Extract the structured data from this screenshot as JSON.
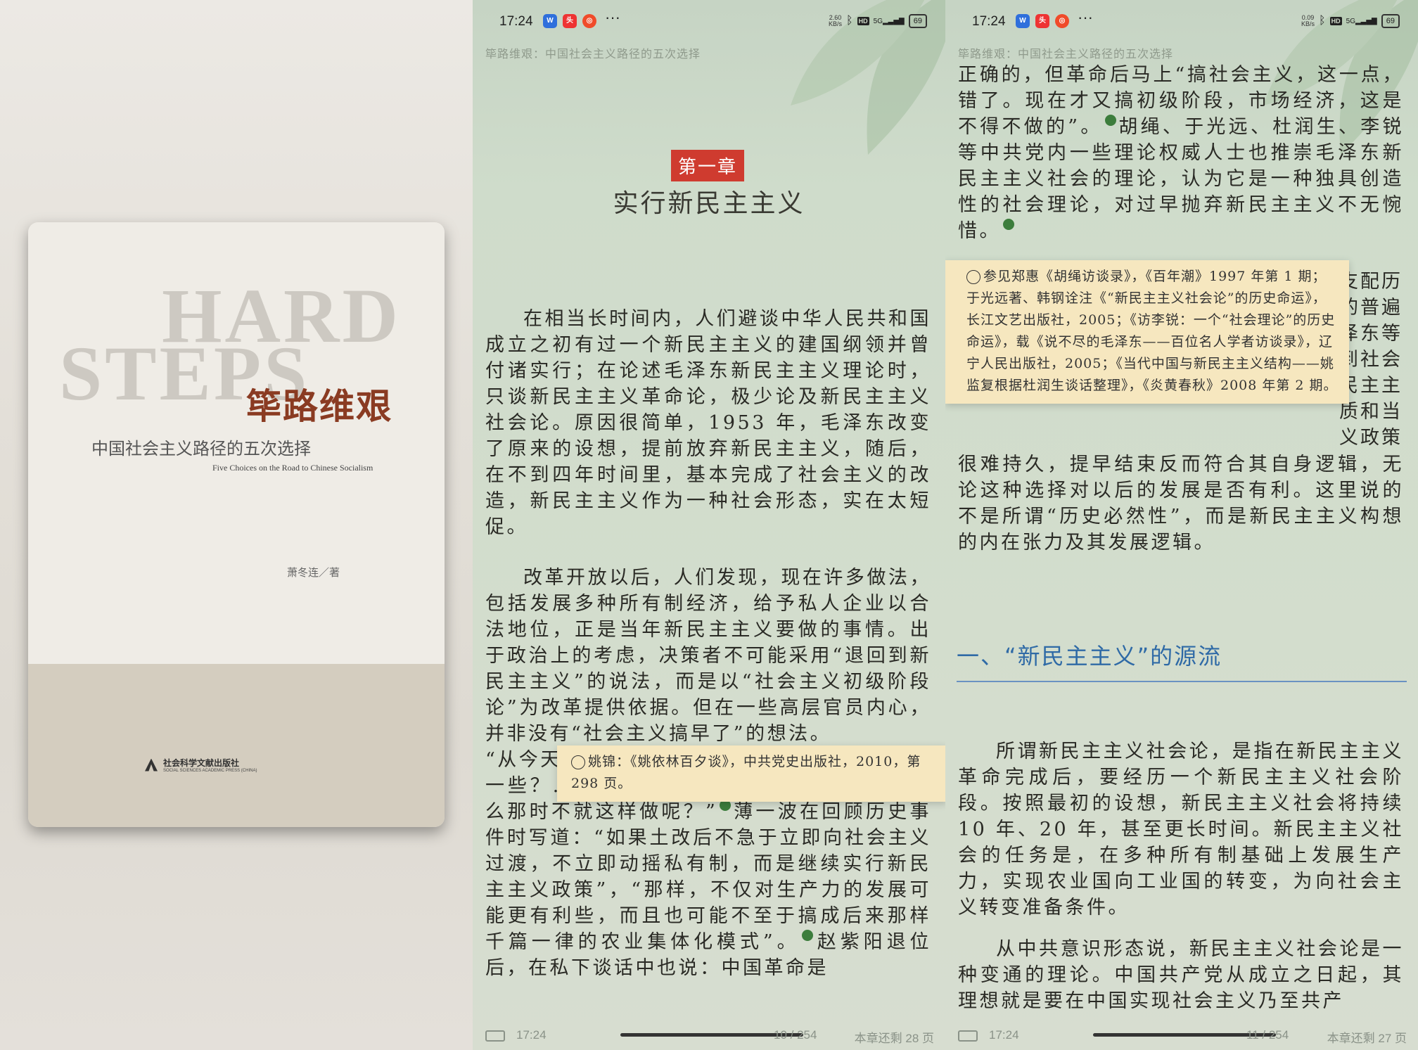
{
  "cover": {
    "ghost_line1": "HARD",
    "ghost_line2": "STEPS",
    "title": "筚路维艰",
    "subtitle": "中国社会主义路径的五次选择",
    "subtitle_en": "Five Choices on the Road to Chinese Socialism",
    "author": "萧冬连／著",
    "publisher_cn": "社会科学文献出版社",
    "publisher_en": "SOCIAL SCIENCES ACADEMIC PRESS (CHINA)"
  },
  "status_bar_mid": {
    "time": "17:24",
    "speed_value": "2.60",
    "speed_unit": "KB/s",
    "hd": "HD",
    "network": "5G",
    "battery": "69"
  },
  "status_bar_right": {
    "time": "17:24",
    "speed_value": "0.09",
    "speed_unit": "KB/s",
    "hd": "HD",
    "network": "5G",
    "battery": "69"
  },
  "mid": {
    "book_header": "筚路维艰：中国社会主义路径的五次选择",
    "chapter_badge": "第一章",
    "chapter_title": "实行新民主主义",
    "para1": "在相当长时间内，人们避谈中华人民共和国成立之初有过一个新民主主义的建国纲领并曾付诸实行；在论述毛泽东新民主主义理论时，只谈新民主主义革命论，极少论及新民主主义社会论。原因很简单，1953 年，毛泽东改变了原来的设想，提前放弃新民主主义，随后，在不到四年时间里，基本完成了社会主义的改造，新民主主义作为一种社会形态，实在太短促。",
    "para2_a": "改革开放以后，人们发现，现在许多做法，包括发展多种所有制经济，给予私人企业以合法地位，正是当年新民主主义要做的事情。出于政治上的考虑，决策者不可能采用“退回到新民主主义”的说法，而是以“社会主义初级阶段论”为改革提供依据。但在一些高层官员内心，并非没有“社会主义搞早了”的想法。",
    "para2_b": "“从今天",
    "para2_c": "一些？……现在许多事情都是退回去做，为什么那时不就这样做呢？”",
    "para2_d": "薄一波在回顾历史事件时写道：“如果土改后不急于立即向社会主义过渡，不立即动摇私有制，而是继续实行新民主主义政策”，“那样，不仅对生产力的发展可能更有利些，而且也可能不至于搞成后来那样千篇一律的农业集体化模式”。",
    "para2_e": "赵紫阳退位后，在私下谈话中也说：中国革命是",
    "popup": "姚锦：《姚依林百夕谈》，中共党史出版社，2010，第 298 页。",
    "bottom_time": "17:24",
    "page": "10 / 254",
    "remaining": "本章还剩 28 页"
  },
  "right": {
    "book_header": "筚路维艰：中国社会主义路径的五次选择",
    "para_top_a": "正确的，但革命后马上“搞社会主义，这一点，错了。现在才又搞初级阶段，市场经济，这是不得不做的”。",
    "para_top_b": "胡绳、于光远、杜润生、李锐等中共党内一些理论权威人士也推崇毛泽东新民主主义社会的理论，认为它是一种独具创造性的社会理论，对过早抛弃新民主主义不无惋惜。",
    "obscured_lines": [
      "支配历",
      "的普遍",
      "泽东等",
      "到社会",
      "民主主",
      "质和当",
      "义政策"
    ],
    "para_mid": "很难持久，提早结束反而符合其自身逻辑，无论这种选择对以后的发展是否有利。这里说的不是所谓“历史必然性”，而是新民主主义构想的内在张力及其发展逻辑。",
    "popup": "参见郑惠《胡绳访谈录》，《百年潮》1997 年第 1 期；于光远著、韩钢诠注《“新民主主义社会论”的历史命运》，长江文艺出版社，2005；《访李锐：一个“社会理论”的历史命运》，载《说不尽的毛泽东——百位名人学者访谈录》，辽宁人民出版社，2005；《当代中国与新民主主义结构——姚监复根据杜润生谈话整理》，《炎黄春秋》2008 年第 2 期。",
    "section_heading": "一、“新民主主义”的源流",
    "para_s1": "所谓新民主主义社会论，是指在新民主主义革命完成后，要经历一个新民主主义社会阶段。按照最初的设想，新民主主义社会将持续 10 年、20 年，甚至更长时间。新民主主义社会的任务是，在多种所有制基础上发展生产力，实现农业国向工业国的转变，为向社会主义转变准备条件。",
    "para_s2": "从中共意识形态说，新民主主义社会论是一种变通的理论。中国共产党从成立之日起，其理想就是要在中国实现社会主义乃至共产",
    "bottom_time": "17:24",
    "page": "11 / 254",
    "remaining": "本章还剩 27 页"
  },
  "colors": {
    "chapter_badge_bg": "#cf3b2f",
    "section_heading": "#2f6aa6",
    "footnote_marker": "#3c7d3c",
    "popup_bg": "#f6e7bf",
    "cover_title": "#8a3b22"
  }
}
